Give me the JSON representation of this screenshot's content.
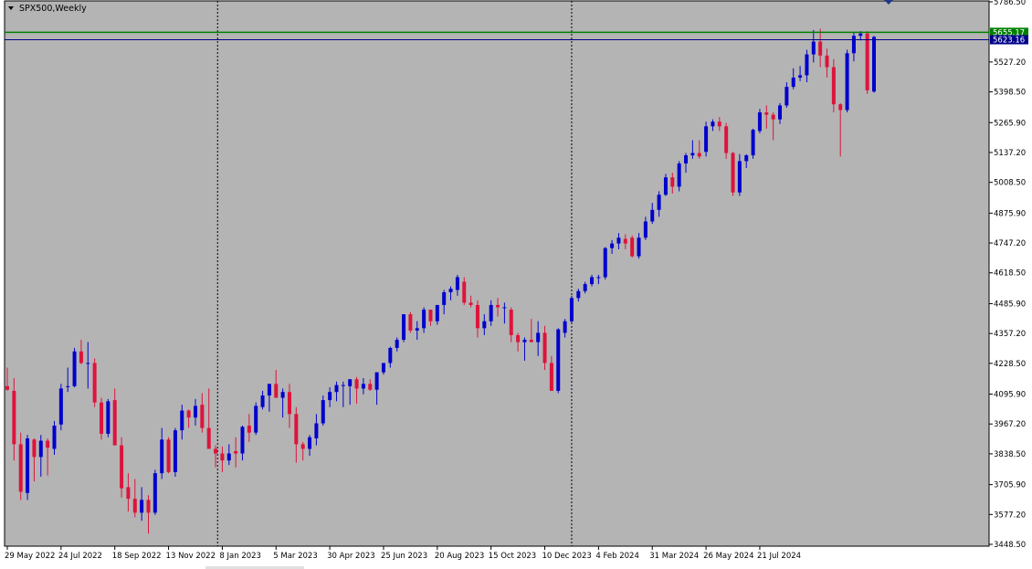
{
  "window": {
    "symbol_label": "SPX500,Weekly"
  },
  "colors": {
    "background": "#b4b4b4",
    "bull": "#0000cd",
    "bear": "#dc143c",
    "wick_bull": "#0000cd",
    "wick_bear": "#dc143c",
    "resistance_line": "#008000",
    "bid_line": "#00008b",
    "grid_separator": "#000000"
  },
  "price_lines": {
    "resistance": {
      "label": "5655.17",
      "value": 5655.17
    },
    "bid": {
      "label": "5623.16",
      "value": 5623.16
    }
  },
  "chart_data": {
    "type": "candlestick",
    "title": "SPX500,Weekly",
    "ylim": [
      3448.5,
      5786.5
    ],
    "y_ticks": [
      "5786.50",
      "5655.17",
      "5527.20",
      "5398.50",
      "5265.90",
      "5137.20",
      "5008.50",
      "4875.90",
      "4747.20",
      "4618.50",
      "4485.90",
      "4357.20",
      "4228.50",
      "4095.90",
      "3967.20",
      "3838.50",
      "3705.90",
      "3577.20",
      "3448.50"
    ],
    "x_ticks": [
      "29 May 2022",
      "24 Jul 2022",
      "18 Sep 2022",
      "13 Nov 2022",
      "8 Jan 2023",
      "5 Mar 2023",
      "30 Apr 2023",
      "25 Jun 2023",
      "20 Aug 2023",
      "15 Oct 2023",
      "10 Dec 2023",
      "4 Feb 2024",
      "31 Mar 2024",
      "26 May 2024",
      "21 Jul 2024"
    ],
    "period_separators": [
      "1 Jan 2023",
      "1 Jan 2024"
    ],
    "candles": [
      {
        "o": 4130,
        "h": 4210,
        "l": 4110,
        "c": 4115
      },
      {
        "o": 4110,
        "h": 4165,
        "l": 3810,
        "c": 3880
      },
      {
        "o": 3880,
        "h": 3930,
        "l": 3640,
        "c": 3675
      },
      {
        "o": 3670,
        "h": 3920,
        "l": 3640,
        "c": 3905
      },
      {
        "o": 3900,
        "h": 3905,
        "l": 3720,
        "c": 3825
      },
      {
        "o": 3825,
        "h": 3920,
        "l": 3740,
        "c": 3895
      },
      {
        "o": 3895,
        "h": 3905,
        "l": 3745,
        "c": 3865
      },
      {
        "o": 3860,
        "h": 3980,
        "l": 3835,
        "c": 3960
      },
      {
        "o": 3965,
        "h": 4140,
        "l": 3940,
        "c": 4120
      },
      {
        "o": 4130,
        "h": 4210,
        "l": 4105,
        "c": 4130
      },
      {
        "o": 4130,
        "h": 4295,
        "l": 4125,
        "c": 4280
      },
      {
        "o": 4280,
        "h": 4330,
        "l": 4225,
        "c": 4230
      },
      {
        "o": 4230,
        "h": 4320,
        "l": 4120,
        "c": 4230
      },
      {
        "o": 4230,
        "h": 4250,
        "l": 4040,
        "c": 4060
      },
      {
        "o": 4060,
        "h": 4080,
        "l": 3900,
        "c": 3925
      },
      {
        "o": 3925,
        "h": 4075,
        "l": 3910,
        "c": 4065
      },
      {
        "o": 4070,
        "h": 4120,
        "l": 3880,
        "c": 3875
      },
      {
        "o": 3875,
        "h": 3910,
        "l": 3650,
        "c": 3690
      },
      {
        "o": 3695,
        "h": 3755,
        "l": 3590,
        "c": 3645
      },
      {
        "o": 3645,
        "h": 3730,
        "l": 3565,
        "c": 3585
      },
      {
        "o": 3585,
        "h": 3695,
        "l": 3550,
        "c": 3640
      },
      {
        "o": 3640,
        "h": 3660,
        "l": 3495,
        "c": 3585
      },
      {
        "o": 3585,
        "h": 3770,
        "l": 3575,
        "c": 3755
      },
      {
        "o": 3755,
        "h": 3950,
        "l": 3730,
        "c": 3900
      },
      {
        "o": 3900,
        "h": 3910,
        "l": 3755,
        "c": 3760
      },
      {
        "o": 3760,
        "h": 3950,
        "l": 3740,
        "c": 3940
      },
      {
        "o": 3940,
        "h": 4050,
        "l": 3900,
        "c": 4025
      },
      {
        "o": 4025,
        "h": 4030,
        "l": 3950,
        "c": 3995
      },
      {
        "o": 3995,
        "h": 4075,
        "l": 3960,
        "c": 4045
      },
      {
        "o": 4050,
        "h": 4100,
        "l": 3930,
        "c": 3950
      },
      {
        "o": 3950,
        "h": 4120,
        "l": 3880,
        "c": 3860
      },
      {
        "o": 3860,
        "h": 3875,
        "l": 3780,
        "c": 3840
      },
      {
        "o": 3840,
        "h": 3870,
        "l": 3760,
        "c": 3810
      },
      {
        "o": 3810,
        "h": 3880,
        "l": 3790,
        "c": 3840
      },
      {
        "o": 3850,
        "h": 3910,
        "l": 3780,
        "c": 3840
      },
      {
        "o": 3840,
        "h": 3960,
        "l": 3810,
        "c": 3955
      },
      {
        "o": 3960,
        "h": 4010,
        "l": 3890,
        "c": 3930
      },
      {
        "o": 3930,
        "h": 4060,
        "l": 3920,
        "c": 4045
      },
      {
        "o": 4040,
        "h": 4110,
        "l": 4030,
        "c": 4090
      },
      {
        "o": 4090,
        "h": 4140,
        "l": 4020,
        "c": 4140
      },
      {
        "o": 4140,
        "h": 4200,
        "l": 4080,
        "c": 4080
      },
      {
        "o": 4080,
        "h": 4120,
        "l": 3995,
        "c": 4105
      },
      {
        "o": 4105,
        "h": 4140,
        "l": 3950,
        "c": 4010
      },
      {
        "o": 4010,
        "h": 4040,
        "l": 3800,
        "c": 3880
      },
      {
        "o": 3880,
        "h": 3890,
        "l": 3810,
        "c": 3860
      },
      {
        "o": 3860,
        "h": 3920,
        "l": 3830,
        "c": 3910
      },
      {
        "o": 3905,
        "h": 4010,
        "l": 3875,
        "c": 3970
      },
      {
        "o": 3970,
        "h": 4090,
        "l": 3960,
        "c": 4070
      },
      {
        "o": 4070,
        "h": 4125,
        "l": 4040,
        "c": 4105
      },
      {
        "o": 4105,
        "h": 4150,
        "l": 4065,
        "c": 4135
      },
      {
        "o": 4135,
        "h": 4150,
        "l": 4040,
        "c": 4135
      },
      {
        "o": 4130,
        "h": 4160,
        "l": 4050,
        "c": 4160
      },
      {
        "o": 4160,
        "h": 4170,
        "l": 4055,
        "c": 4120
      },
      {
        "o": 4120,
        "h": 4165,
        "l": 4095,
        "c": 4140
      },
      {
        "o": 4140,
        "h": 4160,
        "l": 4110,
        "c": 4115
      },
      {
        "o": 4115,
        "h": 4190,
        "l": 4050,
        "c": 4190
      },
      {
        "o": 4190,
        "h": 4230,
        "l": 4180,
        "c": 4230
      },
      {
        "o": 4230,
        "h": 4300,
        "l": 4210,
        "c": 4295
      },
      {
        "o": 4295,
        "h": 4340,
        "l": 4280,
        "c": 4330
      },
      {
        "o": 4330,
        "h": 4440,
        "l": 4320,
        "c": 4440
      },
      {
        "o": 4440,
        "h": 4450,
        "l": 4360,
        "c": 4370
      },
      {
        "o": 4370,
        "h": 4410,
        "l": 4330,
        "c": 4380
      },
      {
        "o": 4380,
        "h": 4470,
        "l": 4360,
        "c": 4460
      },
      {
        "o": 4460,
        "h": 4460,
        "l": 4390,
        "c": 4410
      },
      {
        "o": 4410,
        "h": 4480,
        "l": 4395,
        "c": 4480
      },
      {
        "o": 4480,
        "h": 4545,
        "l": 4440,
        "c": 4535
      },
      {
        "o": 4535,
        "h": 4560,
        "l": 4500,
        "c": 4550
      },
      {
        "o": 4545,
        "h": 4610,
        "l": 4520,
        "c": 4600
      },
      {
        "o": 4580,
        "h": 4600,
        "l": 4480,
        "c": 4490
      },
      {
        "o": 4490,
        "h": 4520,
        "l": 4470,
        "c": 4480
      },
      {
        "o": 4480,
        "h": 4500,
        "l": 4340,
        "c": 4380
      },
      {
        "o": 4380,
        "h": 4440,
        "l": 4350,
        "c": 4410
      },
      {
        "o": 4410,
        "h": 4500,
        "l": 4390,
        "c": 4480
      },
      {
        "o": 4480,
        "h": 4510,
        "l": 4430,
        "c": 4470
      },
      {
        "o": 4470,
        "h": 4490,
        "l": 4400,
        "c": 4470
      },
      {
        "o": 4460,
        "h": 4470,
        "l": 4320,
        "c": 4350
      },
      {
        "o": 4350,
        "h": 4360,
        "l": 4280,
        "c": 4320
      },
      {
        "o": 4320,
        "h": 4340,
        "l": 4240,
        "c": 4330
      },
      {
        "o": 4330,
        "h": 4420,
        "l": 4320,
        "c": 4320
      },
      {
        "o": 4320,
        "h": 4410,
        "l": 4260,
        "c": 4360
      },
      {
        "o": 4360,
        "h": 4390,
        "l": 4200,
        "c": 4230
      },
      {
        "o": 4230,
        "h": 4260,
        "l": 4130,
        "c": 4110
      },
      {
        "o": 4110,
        "h": 4380,
        "l": 4100,
        "c": 4375
      },
      {
        "o": 4360,
        "h": 4420,
        "l": 4340,
        "c": 4410
      },
      {
        "o": 4410,
        "h": 4520,
        "l": 4400,
        "c": 4510
      },
      {
        "o": 4510,
        "h": 4550,
        "l": 4495,
        "c": 4540
      },
      {
        "o": 4540,
        "h": 4580,
        "l": 4530,
        "c": 4570
      },
      {
        "o": 4570,
        "h": 4610,
        "l": 4560,
        "c": 4600
      },
      {
        "o": 4600,
        "h": 4610,
        "l": 4570,
        "c": 4600
      },
      {
        "o": 4600,
        "h": 4730,
        "l": 4590,
        "c": 4725
      },
      {
        "o": 4725,
        "h": 4760,
        "l": 4700,
        "c": 4745
      },
      {
        "o": 4745,
        "h": 4790,
        "l": 4720,
        "c": 4770
      },
      {
        "o": 4765,
        "h": 4785,
        "l": 4720,
        "c": 4745
      },
      {
        "o": 4770,
        "h": 4780,
        "l": 4685,
        "c": 4690
      },
      {
        "o": 4690,
        "h": 4790,
        "l": 4680,
        "c": 4770
      },
      {
        "o": 4770,
        "h": 4860,
        "l": 4760,
        "c": 4840
      },
      {
        "o": 4840,
        "h": 4920,
        "l": 4830,
        "c": 4890
      },
      {
        "o": 4890,
        "h": 4970,
        "l": 4860,
        "c": 4955
      },
      {
        "o": 4955,
        "h": 5045,
        "l": 4950,
        "c": 5030
      },
      {
        "o": 5030,
        "h": 5050,
        "l": 4960,
        "c": 4990
      },
      {
        "o": 4990,
        "h": 5100,
        "l": 4970,
        "c": 5090
      },
      {
        "o": 5090,
        "h": 5135,
        "l": 5050,
        "c": 5125
      },
      {
        "o": 5125,
        "h": 5190,
        "l": 5110,
        "c": 5135
      },
      {
        "o": 5135,
        "h": 5190,
        "l": 5110,
        "c": 5120
      },
      {
        "o": 5140,
        "h": 5270,
        "l": 5120,
        "c": 5250
      },
      {
        "o": 5250,
        "h": 5280,
        "l": 5230,
        "c": 5270
      },
      {
        "o": 5270,
        "h": 5290,
        "l": 5230,
        "c": 5250
      },
      {
        "o": 5250,
        "h": 5265,
        "l": 5110,
        "c": 5135
      },
      {
        "o": 5135,
        "h": 5140,
        "l": 4950,
        "c": 4965
      },
      {
        "o": 4965,
        "h": 5130,
        "l": 4950,
        "c": 5100
      },
      {
        "o": 5100,
        "h": 5130,
        "l": 5070,
        "c": 5125
      },
      {
        "o": 5125,
        "h": 5240,
        "l": 5110,
        "c": 5235
      },
      {
        "o": 5230,
        "h": 5325,
        "l": 5220,
        "c": 5310
      },
      {
        "o": 5310,
        "h": 5340,
        "l": 5240,
        "c": 5300
      },
      {
        "o": 5300,
        "h": 5310,
        "l": 5190,
        "c": 5280
      },
      {
        "o": 5280,
        "h": 5350,
        "l": 5260,
        "c": 5340
      },
      {
        "o": 5340,
        "h": 5440,
        "l": 5330,
        "c": 5420
      },
      {
        "o": 5420,
        "h": 5500,
        "l": 5410,
        "c": 5460
      },
      {
        "o": 5460,
        "h": 5510,
        "l": 5445,
        "c": 5470
      },
      {
        "o": 5470,
        "h": 5580,
        "l": 5440,
        "c": 5560
      },
      {
        "o": 5560,
        "h": 5665,
        "l": 5525,
        "c": 5615
      },
      {
        "o": 5615,
        "h": 5670,
        "l": 5505,
        "c": 5555
      },
      {
        "o": 5555,
        "h": 5585,
        "l": 5460,
        "c": 5505
      },
      {
        "o": 5505,
        "h": 5540,
        "l": 5310,
        "c": 5345
      },
      {
        "o": 5345,
        "h": 5350,
        "l": 5120,
        "c": 5320
      },
      {
        "o": 5320,
        "h": 5580,
        "l": 5310,
        "c": 5565
      },
      {
        "o": 5565,
        "h": 5655,
        "l": 5530,
        "c": 5640
      },
      {
        "o": 5640,
        "h": 5660,
        "l": 5620,
        "c": 5650
      },
      {
        "o": 5650,
        "h": 5660,
        "l": 5390,
        "c": 5405
      },
      {
        "o": 5400,
        "h": 5640,
        "l": 5395,
        "c": 5635
      }
    ]
  }
}
